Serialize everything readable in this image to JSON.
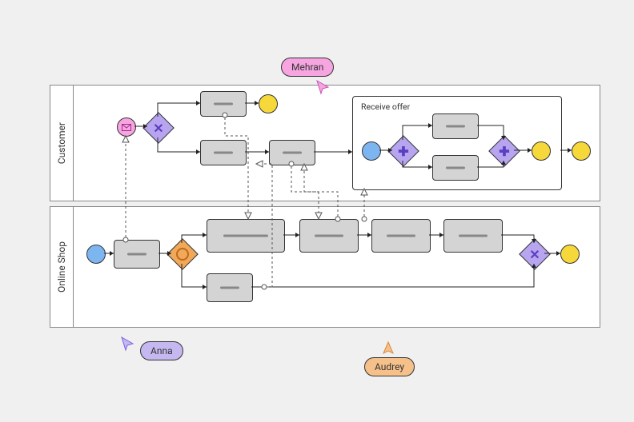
{
  "diagram": {
    "type": "bpmn",
    "pools": {
      "customer": {
        "label": "Customer"
      },
      "online_shop": {
        "label": "Online Shop"
      }
    },
    "subprocess": {
      "label": "Receive offer"
    },
    "cursors": {
      "mehran": {
        "name": "Mehran",
        "color": "#f6a5e0"
      },
      "anna": {
        "name": "Anna",
        "color": "#c5b8f0"
      },
      "audrey": {
        "name": "Audrey",
        "color": "#f5c08a"
      }
    }
  }
}
